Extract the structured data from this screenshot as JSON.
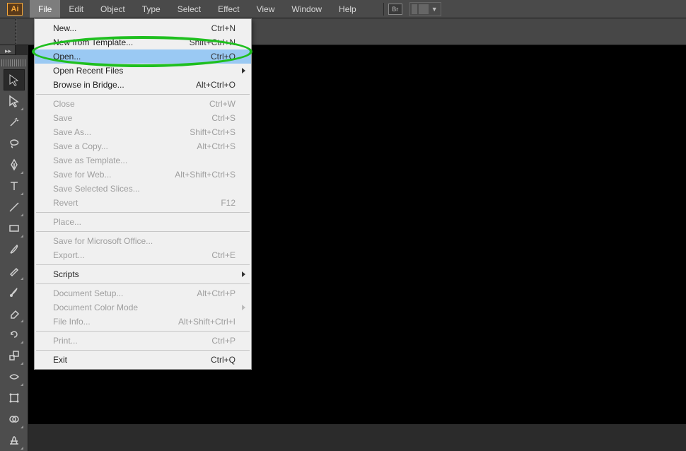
{
  "app": {
    "abbrev": "Ai",
    "bridgeAbbrev": "Br"
  },
  "menubar": [
    "File",
    "Edit",
    "Object",
    "Type",
    "Select",
    "Effect",
    "View",
    "Window",
    "Help"
  ],
  "menubarActiveIndex": 0,
  "fileMenu": {
    "groups": [
      [
        {
          "label": "New...",
          "shortcut": "Ctrl+N"
        },
        {
          "label": "New from Template...",
          "shortcut": "Shift+Ctrl+N"
        },
        {
          "label": "Open...",
          "shortcut": "Ctrl+O",
          "highlighted": true
        },
        {
          "label": "Open Recent Files",
          "submenu": true
        },
        {
          "label": "Browse in Bridge...",
          "shortcut": "Alt+Ctrl+O"
        }
      ],
      [
        {
          "label": "Close",
          "shortcut": "Ctrl+W",
          "disabled": true
        },
        {
          "label": "Save",
          "shortcut": "Ctrl+S",
          "disabled": true
        },
        {
          "label": "Save As...",
          "shortcut": "Shift+Ctrl+S",
          "disabled": true
        },
        {
          "label": "Save a Copy...",
          "shortcut": "Alt+Ctrl+S",
          "disabled": true
        },
        {
          "label": "Save as Template...",
          "disabled": true
        },
        {
          "label": "Save for Web...",
          "shortcut": "Alt+Shift+Ctrl+S",
          "disabled": true
        },
        {
          "label": "Save Selected Slices...",
          "disabled": true
        },
        {
          "label": "Revert",
          "shortcut": "F12",
          "disabled": true
        }
      ],
      [
        {
          "label": "Place...",
          "disabled": true
        }
      ],
      [
        {
          "label": "Save for Microsoft Office...",
          "disabled": true
        },
        {
          "label": "Export...",
          "shortcut": "Ctrl+E",
          "disabled": true
        }
      ],
      [
        {
          "label": "Scripts",
          "submenu": true
        }
      ],
      [
        {
          "label": "Document Setup...",
          "shortcut": "Alt+Ctrl+P",
          "disabled": true
        },
        {
          "label": "Document Color Mode",
          "submenu": true,
          "disabled": true
        },
        {
          "label": "File Info...",
          "shortcut": "Alt+Shift+Ctrl+I",
          "disabled": true
        }
      ],
      [
        {
          "label": "Print...",
          "shortcut": "Ctrl+P",
          "disabled": true
        }
      ],
      [
        {
          "label": "Exit",
          "shortcut": "Ctrl+Q"
        }
      ]
    ]
  },
  "tools": [
    {
      "name": "selection-tool",
      "selected": true,
      "tri": false
    },
    {
      "name": "direct-selection-tool",
      "tri": true
    },
    {
      "name": "magic-wand-tool",
      "tri": false
    },
    {
      "name": "lasso-tool",
      "tri": false
    },
    {
      "name": "pen-tool",
      "tri": true
    },
    {
      "name": "type-tool",
      "tri": true
    },
    {
      "name": "line-segment-tool",
      "tri": true
    },
    {
      "name": "rectangle-tool",
      "tri": true
    },
    {
      "name": "paintbrush-tool",
      "tri": false
    },
    {
      "name": "pencil-tool",
      "tri": true
    },
    {
      "name": "blob-brush-tool",
      "tri": false
    },
    {
      "name": "eraser-tool",
      "tri": true
    },
    {
      "name": "rotate-tool",
      "tri": true
    },
    {
      "name": "scale-tool",
      "tri": true
    },
    {
      "name": "width-tool",
      "tri": true
    },
    {
      "name": "free-transform-tool",
      "tri": false
    },
    {
      "name": "shape-builder-tool",
      "tri": true
    },
    {
      "name": "perspective-grid-tool",
      "tri": true
    }
  ]
}
